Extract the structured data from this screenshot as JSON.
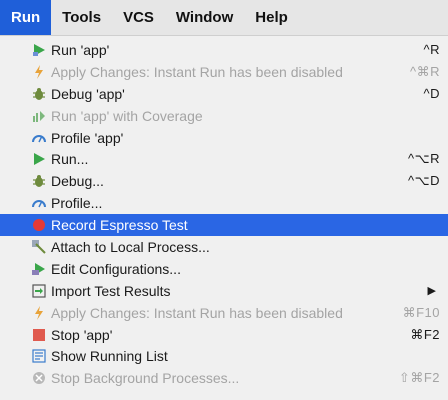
{
  "menubar": {
    "items": [
      "Run",
      "Tools",
      "VCS",
      "Window",
      "Help"
    ]
  },
  "menu": {
    "items": [
      {
        "label": "Run 'app'",
        "shortcut": "^R",
        "icon": "run-app-icon",
        "disabled": false
      },
      {
        "label": "Apply Changes: Instant Run has been disabled",
        "shortcut": "^⌘R",
        "icon": "lightning-icon",
        "disabled": true
      },
      {
        "label": "Debug 'app'",
        "shortcut": "^D",
        "icon": "bug-icon",
        "disabled": false
      },
      {
        "label": "Run 'app' with Coverage",
        "shortcut": "",
        "icon": "coverage-icon",
        "disabled": true
      },
      {
        "label": "Profile 'app'",
        "shortcut": "",
        "icon": "profile-icon",
        "disabled": false
      },
      {
        "label": "Run...",
        "shortcut": "^⌥R",
        "icon": "run-icon",
        "disabled": false
      },
      {
        "label": "Debug...",
        "shortcut": "^⌥D",
        "icon": "bug-icon",
        "disabled": false
      },
      {
        "label": "Profile...",
        "shortcut": "",
        "icon": "profile-icon",
        "disabled": false
      },
      {
        "label": "Record Espresso Test",
        "shortcut": "",
        "icon": "record-icon",
        "disabled": false,
        "selected": true
      },
      {
        "label": "Attach to Local Process...",
        "shortcut": "",
        "icon": "attach-icon",
        "disabled": false
      },
      {
        "label": "Edit Configurations...",
        "shortcut": "",
        "icon": "edit-config-icon",
        "disabled": false
      },
      {
        "label": "Import Test Results",
        "shortcut": "",
        "icon": "import-icon",
        "disabled": false,
        "submenu": "▶"
      },
      {
        "label": "Apply Changes: Instant Run has been disabled",
        "shortcut": "⌘F10",
        "icon": "lightning-icon",
        "disabled": true
      },
      {
        "label": "Stop 'app'",
        "shortcut": "⌘F2",
        "icon": "stop-icon",
        "disabled": false
      },
      {
        "label": "Show Running List",
        "shortcut": "",
        "icon": "list-icon",
        "disabled": false
      },
      {
        "label": "Stop Background Processes...",
        "shortcut": "⇧⌘F2",
        "icon": "stop-background-icon",
        "disabled": true
      }
    ]
  },
  "colors": {
    "accent": "#2a66e4",
    "run_green": "#3aa64a",
    "lightning_orange": "#e8a33a",
    "record_red": "#e53935",
    "stop_red": "#e05a4e"
  }
}
